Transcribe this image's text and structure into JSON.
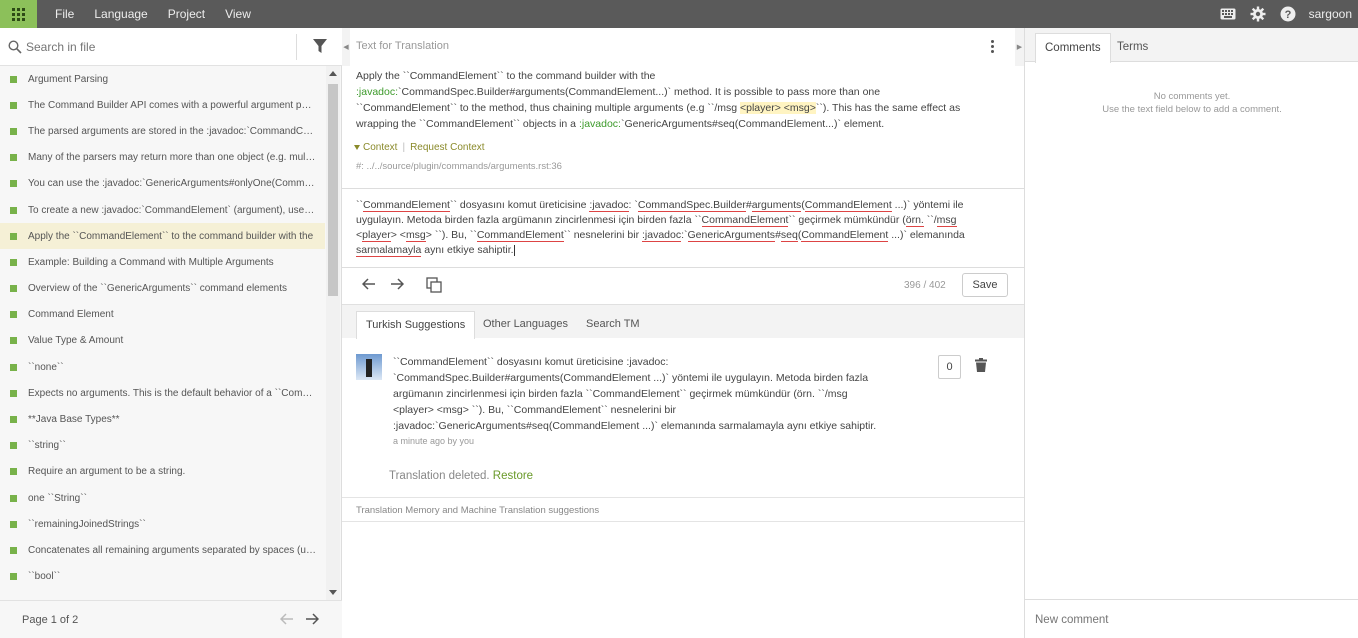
{
  "menu": [
    "File",
    "Language",
    "Project",
    "View"
  ],
  "user": "sargoon",
  "left": {
    "search_placeholder": "Search in file",
    "items": [
      "Argument Parsing",
      "The Command Builder API comes with a powerful argument parser for converting the string input to java base types. However, arguments for commands can be created with",
      "The parsed arguments are stored in the :javadoc:`CommandContext` object.",
      "Many of the parsers may return more than one object (e.g. multiple online players with a matching username).",
      "You can use the :javadoc:`GenericArguments#onlyOne(CommandElement)`",
      "To create a new :javadoc:`CommandElement` (argument), use the :javadoc:`GenericArguments`",
      "Apply the ``CommandElement`` to the command builder with the",
      "Example: Building a Command with Multiple Arguments",
      "Overview of the ``GenericArguments`` command elements",
      "Command Element",
      "Value Type & Amount",
      "``none``",
      "Expects no arguments. This is the default behavior of a ``CommandSpec``.",
      "**Java Base Types**",
      "``string``",
      "Require an argument to be a string.",
      "one ``String``",
      "``remainingJoinedStrings``",
      "Concatenates all remaining arguments separated by spaces (useful for message commands).",
      "``bool``"
    ],
    "selected_index": 6,
    "pager_text": "Page 1 of 2"
  },
  "source": {
    "header": "Text for Translation",
    "p1": "Apply the ``CommandElement`` to the command builder with the",
    "p2_green": ":javadoc:",
    "p2_rest": "`CommandSpec.Builder#arguments(CommandElement...)` method. It is possible to pass more than one",
    "p3_a": "``CommandElement`` to the method, thus chaining multiple arguments (e.g ``/msg ",
    "p3_hl": "<player> <msg>",
    "p3_b": "``). This has the same effect as",
    "p4_a": "wrapping the ``CommandElement`` objects in a ",
    "p4_green": ":javadoc:",
    "p4_b": "`GenericArguments#seq(CommandElement...)` element.",
    "context_label": "Context",
    "request_context": "Request Context",
    "ref": "#: ../../source/plugin/commands/arguments.rst:36"
  },
  "translation": {
    "l1a": "``",
    "l1b": "CommandElement",
    "l1c": "`` dosyasını komut üreticisine ",
    "l1d": ":javadoc",
    "l1e": ": `",
    "l1f": "CommandSpec.Builder",
    "l1g": "#",
    "l1h": "arguments",
    "l1i": "(",
    "l1j": "CommandElement",
    "l1k": " ...)` yöntemi ile",
    "l2a": "uygulayın. Metoda birden fazla argümanın zincirlenmesi için birden fazla ``",
    "l2b": "CommandElement",
    "l2c": "`` geçirmek mümkündür (",
    "l2d": "örn.",
    "l2e": " ``/",
    "l2f": "msg",
    "l3a": "<",
    "l3b": "player",
    "l3c": "> <",
    "l3d": "msg",
    "l3e": "> ``). Bu, ``",
    "l3f": "CommandElement",
    "l3g": "`` nesnelerini bir ",
    "l3h": ":javadoc",
    "l3i": ":`",
    "l3j": "GenericArguments",
    "l3k": "#",
    "l3l": "seq",
    "l3m": "(",
    "l3n": "CommandElement",
    "l3o": " ...)` elemanında",
    "l4a": "sarmalamayla",
    "l4b": " aynı etkiye sahiptir."
  },
  "actions": {
    "count": "396 / 402",
    "save": "Save"
  },
  "tabs": [
    "Turkish Suggestions",
    "Other Languages",
    "Search TM"
  ],
  "suggestion": {
    "lines": [
      "``CommandElement`` dosyasını komut üreticisine :javadoc:",
      "`CommandSpec.Builder#arguments(CommandElement ...)` yöntemi ile uygulayın. Metoda birden fazla",
      "argümanın zincirlenmesi için birden fazla ``CommandElement`` geçirmek mümkündür (örn. ``/msg",
      "<player> <msg> ``). Bu, ``CommandElement`` nesnelerini bir",
      ":javadoc:`GenericArguments#seq(CommandElement ...)` elemanında sarmalamayla aynı etkiye sahiptir."
    ],
    "meta": "a minute ago by you",
    "votes": "0",
    "deleted_text": "Translation deleted.",
    "restore": "Restore"
  },
  "tm_header": "Translation Memory and Machine Translation suggestions",
  "right": {
    "tabs": [
      "Comments",
      "Terms"
    ],
    "no_comments": "No comments yet.",
    "hint": "Use the text field below to add a comment.",
    "new_comment_placeholder": "New comment"
  },
  "colors": {
    "accent": "#8cc05a",
    "topbar": "#5a5a5a",
    "dot": "#78b24a",
    "selected_row": "#f5f0d6"
  }
}
